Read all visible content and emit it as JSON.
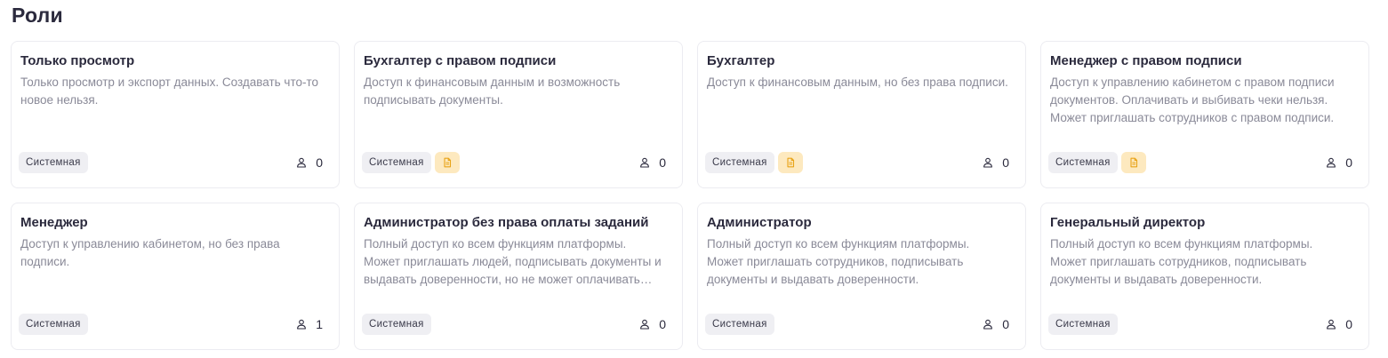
{
  "page": {
    "title": "Роли"
  },
  "roles": [
    {
      "title": "Только просмотр",
      "description": "Только просмотр и экспорт данных. Создавать что-то новое нельзя.",
      "badge": "Системная",
      "sign_icon": false,
      "users": "0"
    },
    {
      "title": "Бухгалтер с правом подписи",
      "description": "Доступ к финансовым данным и возможность подписывать документы.",
      "badge": "Системная",
      "sign_icon": true,
      "users": "0"
    },
    {
      "title": "Бухгалтер",
      "description": "Доступ к финансовым данным, но без права подписи.",
      "badge": "Системная",
      "sign_icon": true,
      "users": "0"
    },
    {
      "title": "Менеджер с правом подписи",
      "description": "Доступ к управлению кабинетом с правом подписи документов. Оплачивать и выбивать чеки нельзя. Может приглашать сотрудников с правом подписи.",
      "badge": "Системная",
      "sign_icon": true,
      "users": "0"
    },
    {
      "title": "Менеджер",
      "description": "Доступ к управлению кабинетом, но без права подписи.",
      "badge": "Системная",
      "sign_icon": false,
      "users": "1"
    },
    {
      "title": "Администратор без права оплаты заданий",
      "description": "Полный доступ ко всем функциям платформы. Может приглашать людей, подписывать документы и выдавать доверенности, но не может оплачивать задания.",
      "badge": "Системная",
      "sign_icon": false,
      "users": "0"
    },
    {
      "title": "Администратор",
      "description": "Полный доступ ко всем функциям платформы. Может приглашать сотрудников, подписывать документы и выдавать доверенности.",
      "badge": "Системная",
      "sign_icon": false,
      "users": "0"
    },
    {
      "title": "Генеральный директор",
      "description": "Полный доступ ко всем функциям платформы. Может приглашать сотрудников, подписывать документы и выдавать доверенности.",
      "badge": "Системная",
      "sign_icon": false,
      "users": "0"
    }
  ],
  "colors": {
    "sign_badge_bg": "#fde9bf",
    "sign_icon": "#e8a317",
    "system_badge_bg": "#efeff3"
  }
}
